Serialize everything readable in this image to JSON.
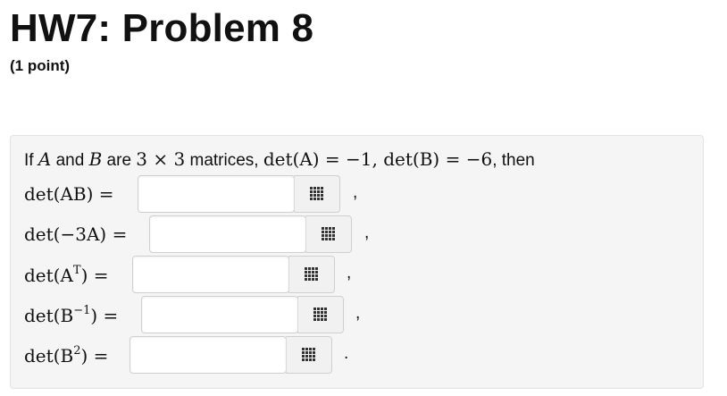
{
  "page": {
    "title": "HW7: Problem 8",
    "points": "(1 point)"
  },
  "question": {
    "intro_if": "If ",
    "var_a": "A",
    "and": " and ",
    "var_b": "B",
    "are": " are ",
    "dim": "3 × 3",
    "matrices": " matrices, ",
    "det_a": "det(A) = −1",
    "comma1": ", ",
    "det_b": "det(B) = −6",
    "then": ", then"
  },
  "items": [
    {
      "label": "det(AB) =",
      "value": "",
      "punct": ",",
      "icon": "grid-icon"
    },
    {
      "label": "det(−3A) =",
      "value": "",
      "punct": ",",
      "icon": "grid-icon"
    },
    {
      "label_base": "det(A",
      "label_sup": "T",
      "label_end": ") =",
      "value": "",
      "punct": ",",
      "icon": "grid-icon"
    },
    {
      "label_base": "det(B",
      "label_sup": "−1",
      "label_end": ") =",
      "value": "",
      "punct": ",",
      "icon": "grid-icon"
    },
    {
      "label_base": "det(B",
      "label_sup": "2",
      "label_end": ") =",
      "value": "",
      "punct": ".",
      "icon": "grid-icon"
    }
  ]
}
